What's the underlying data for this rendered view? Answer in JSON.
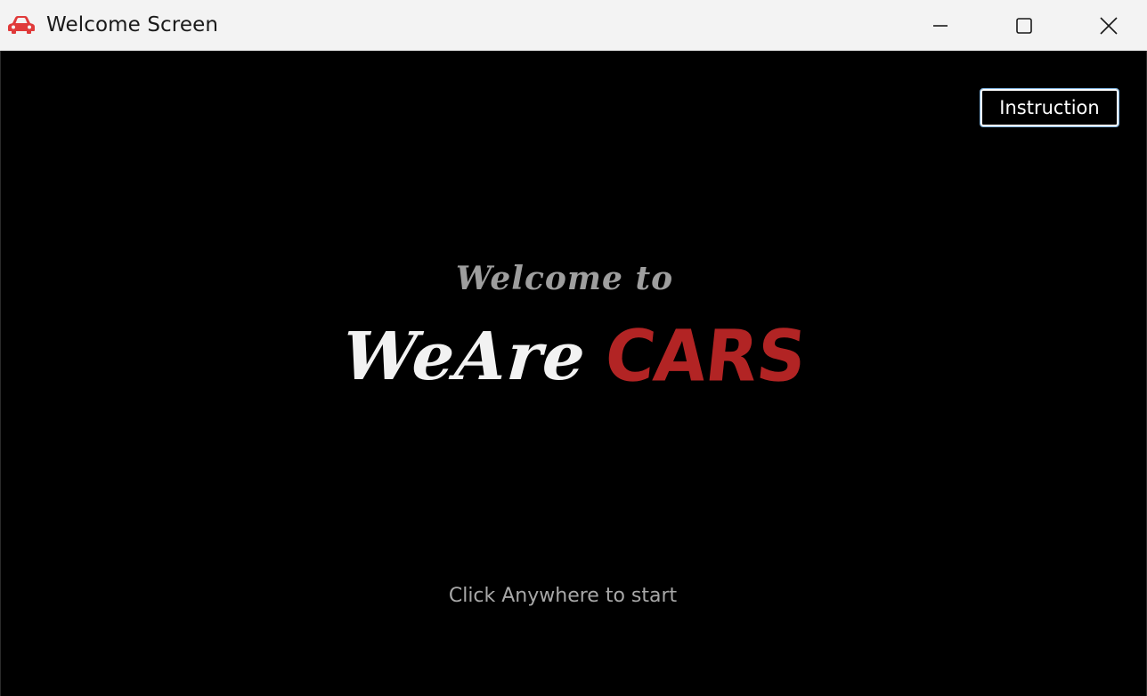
{
  "window": {
    "title": "Welcome Screen",
    "app_icon": "car-icon",
    "accent_color": "#e03a3a",
    "controls": {
      "minimize_icon": "minimize-icon",
      "maximize_icon": "maximize-icon",
      "close_icon": "close-icon"
    }
  },
  "main": {
    "instruction_button": "Instruction",
    "welcome_line": "Welcome to",
    "logo_white": "WeAre",
    "logo_red": "CARS",
    "logo_red_color": "#b22424",
    "start_prompt": "Click Anywhere to start"
  }
}
